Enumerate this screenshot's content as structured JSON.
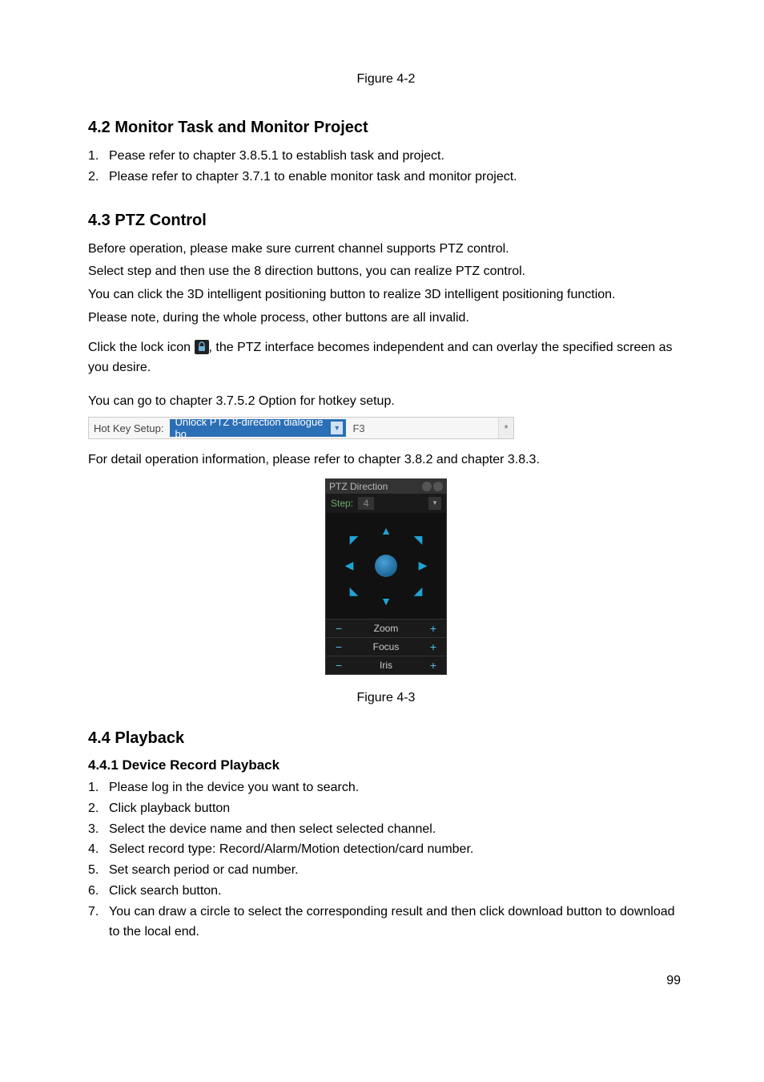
{
  "page_number": "99",
  "figure_top": "Figure 4-2",
  "section42": {
    "heading": "4.2  Monitor Task and Monitor Project",
    "items": [
      {
        "num": "1.",
        "text": "Pease refer to chapter 3.8.5.1 to establish task and project."
      },
      {
        "num": "2.",
        "text": "Please refer to chapter 3.7.1 to enable monitor task and monitor project."
      }
    ]
  },
  "section43": {
    "heading": "4.3  PTZ Control",
    "paras": [
      "Before operation, please make sure current channel supports PTZ control.",
      "Select step and then use the 8 direction buttons, you can realize PTZ control.",
      "You can click the 3D intelligent positioning button to realize 3D intelligent positioning function.",
      "Please note, during the whole process, other buttons are all invalid."
    ],
    "lock_pre": "Click the lock icon",
    "lock_post": ", the PTZ interface becomes independent and can overlay the specified screen as you desire.",
    "hotkey_intro": "You can go to chapter 3.7.5.2 Option for hotkey setup.",
    "detail_note": "For detail operation information, please refer to chapter 3.8.2 and chapter 3.8.3."
  },
  "hotkey": {
    "label": "Hot Key Setup:",
    "selected": "Unlock PTZ 8-direction dialogue bo",
    "value": "F3",
    "asterisk": "*"
  },
  "ptz": {
    "title": "PTZ Direction",
    "step_label": "Step:",
    "step_value": "4",
    "rows": [
      {
        "minus": "−",
        "label": "Zoom",
        "plus": "+"
      },
      {
        "minus": "−",
        "label": "Focus",
        "plus": "+"
      },
      {
        "minus": "−",
        "label": "Iris",
        "plus": "+"
      }
    ]
  },
  "figure_ptz": "Figure 4-3",
  "section44": {
    "heading": "4.4  Playback",
    "sub_heading": "4.4.1  Device Record Playback",
    "items": [
      {
        "num": "1.",
        "text": "Please log in the device you want to search."
      },
      {
        "num": "2.",
        "text": "Click playback button"
      },
      {
        "num": "3.",
        "text": "Select the device name and then select selected channel."
      },
      {
        "num": "4.",
        "text": "Select record type: Record/Alarm/Motion detection/card number."
      },
      {
        "num": "5.",
        "text": "Set search period or cad number."
      },
      {
        "num": "6.",
        "text": "Click search button."
      },
      {
        "num": "7.",
        "text": "You can draw a circle to select the corresponding result and then click download button to download to the local end."
      }
    ]
  }
}
